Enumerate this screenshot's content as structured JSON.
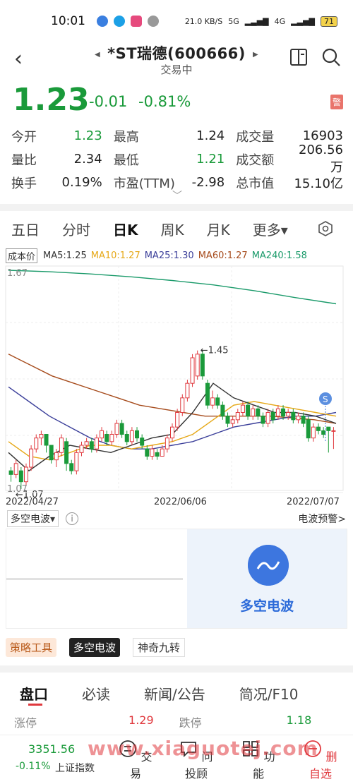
{
  "status_bar": {
    "time": "10:01",
    "net_speed": "21.0 KB/S",
    "signal1": "5G",
    "signal2": "4G",
    "battery": "71"
  },
  "header": {
    "title": "*ST瑞德(600666)",
    "subtitle": "交易中",
    "back_icon": "chevron-left-icon",
    "left_icon": "book-icon",
    "right_icon": "search-icon"
  },
  "quote": {
    "price": "1.23",
    "change": "-0.01",
    "change_pct": "-0.81%",
    "warn_badge": "警",
    "price_color": "#1a9a3a"
  },
  "stats": [
    [
      {
        "label": "今开",
        "value": "1.23",
        "color": "green"
      },
      {
        "label": "最高",
        "value": "1.24",
        "color": "black"
      },
      {
        "label": "成交量",
        "value": "16903",
        "color": "black"
      }
    ],
    [
      {
        "label": "量比",
        "value": "2.34",
        "color": "black"
      },
      {
        "label": "最低",
        "value": "1.21",
        "color": "green"
      },
      {
        "label": "成交额",
        "value": "206.56万",
        "color": "black"
      }
    ],
    [
      {
        "label": "换手",
        "value": "0.19%",
        "color": "black"
      },
      {
        "label": "市盈(TTM)",
        "value": "-2.98",
        "color": "black"
      },
      {
        "label": "总市值",
        "value": "15.10亿",
        "color": "black"
      }
    ]
  ],
  "tabs": [
    "五日",
    "分时",
    "日K",
    "周K",
    "月K",
    "更多▾"
  ],
  "active_tab": "日K",
  "ma_legend": {
    "box": "成本价",
    "items": [
      {
        "text": "MA5:1.25",
        "color": "#333333"
      },
      {
        "text": "MA10:1.27",
        "color": "#e6a817"
      },
      {
        "text": "MA25:1.30",
        "color": "#3b3f9a"
      },
      {
        "text": "MA60:1.27",
        "color": "#a64b1c"
      },
      {
        "text": "MA240:1.58",
        "color": "#1a9a6a"
      }
    ]
  },
  "chart_data": {
    "type": "candlestick",
    "y_top_label": "1.67",
    "y_bottom_label": "1.07",
    "ylim": [
      1.07,
      1.67
    ],
    "high_marker": "←1.45",
    "low_marker": "←1.07",
    "signal_badge": "S",
    "x_labels": [
      "2022/04/27",
      "2022/06/06",
      "2022/07/07"
    ],
    "candles": [
      {
        "o": 1.12,
        "c": 1.11,
        "h": 1.13,
        "l": 1.09
      },
      {
        "o": 1.11,
        "c": 1.14,
        "h": 1.15,
        "l": 1.1
      },
      {
        "o": 1.12,
        "c": 1.09,
        "h": 1.13,
        "l": 1.07
      },
      {
        "o": 1.09,
        "c": 1.13,
        "h": 1.14,
        "l": 1.08
      },
      {
        "o": 1.13,
        "c": 1.18,
        "h": 1.19,
        "l": 1.12
      },
      {
        "o": 1.18,
        "c": 1.21,
        "h": 1.22,
        "l": 1.17
      },
      {
        "o": 1.21,
        "c": 1.22,
        "h": 1.23,
        "l": 1.19
      },
      {
        "o": 1.22,
        "c": 1.19,
        "h": 1.22,
        "l": 1.17
      },
      {
        "o": 1.19,
        "c": 1.15,
        "h": 1.19,
        "l": 1.14
      },
      {
        "o": 1.15,
        "c": 1.17,
        "h": 1.18,
        "l": 1.13
      },
      {
        "o": 1.17,
        "c": 1.21,
        "h": 1.22,
        "l": 1.16
      },
      {
        "o": 1.2,
        "c": 1.14,
        "h": 1.21,
        "l": 1.12
      },
      {
        "o": 1.14,
        "c": 1.12,
        "h": 1.15,
        "l": 1.11
      },
      {
        "o": 1.12,
        "c": 1.17,
        "h": 1.18,
        "l": 1.11
      },
      {
        "o": 1.17,
        "c": 1.19,
        "h": 1.2,
        "l": 1.16
      },
      {
        "o": 1.19,
        "c": 1.2,
        "h": 1.21,
        "l": 1.18
      },
      {
        "o": 1.2,
        "c": 1.18,
        "h": 1.21,
        "l": 1.17
      },
      {
        "o": 1.18,
        "c": 1.21,
        "h": 1.22,
        "l": 1.17
      },
      {
        "o": 1.21,
        "c": 1.23,
        "h": 1.24,
        "l": 1.2
      },
      {
        "o": 1.22,
        "c": 1.2,
        "h": 1.23,
        "l": 1.19
      },
      {
        "o": 1.2,
        "c": 1.22,
        "h": 1.23,
        "l": 1.19
      },
      {
        "o": 1.22,
        "c": 1.25,
        "h": 1.26,
        "l": 1.21
      },
      {
        "o": 1.25,
        "c": 1.22,
        "h": 1.26,
        "l": 1.21
      },
      {
        "o": 1.22,
        "c": 1.2,
        "h": 1.23,
        "l": 1.19
      },
      {
        "o": 1.2,
        "c": 1.23,
        "h": 1.24,
        "l": 1.19
      },
      {
        "o": 1.23,
        "c": 1.21,
        "h": 1.24,
        "l": 1.2
      },
      {
        "o": 1.21,
        "c": 1.19,
        "h": 1.22,
        "l": 1.18
      },
      {
        "o": 1.18,
        "c": 1.16,
        "h": 1.19,
        "l": 1.15
      },
      {
        "o": 1.16,
        "c": 1.18,
        "h": 1.19,
        "l": 1.15
      },
      {
        "o": 1.17,
        "c": 1.16,
        "h": 1.18,
        "l": 1.15
      },
      {
        "o": 1.16,
        "c": 1.18,
        "h": 1.19,
        "l": 1.16
      },
      {
        "o": 1.18,
        "c": 1.21,
        "h": 1.22,
        "l": 1.17
      },
      {
        "o": 1.21,
        "c": 1.24,
        "h": 1.25,
        "l": 1.2
      },
      {
        "o": 1.24,
        "c": 1.28,
        "h": 1.29,
        "l": 1.23
      },
      {
        "o": 1.28,
        "c": 1.32,
        "h": 1.33,
        "l": 1.27
      },
      {
        "o": 1.32,
        "c": 1.36,
        "h": 1.37,
        "l": 1.31
      },
      {
        "o": 1.36,
        "c": 1.43,
        "h": 1.44,
        "l": 1.35
      },
      {
        "o": 1.38,
        "c": 1.44,
        "h": 1.45,
        "l": 1.37
      },
      {
        "o": 1.44,
        "c": 1.38,
        "h": 1.45,
        "l": 1.37
      },
      {
        "o": 1.36,
        "c": 1.3,
        "h": 1.37,
        "l": 1.29
      },
      {
        "o": 1.3,
        "c": 1.32,
        "h": 1.34,
        "l": 1.29
      },
      {
        "o": 1.32,
        "c": 1.3,
        "h": 1.33,
        "l": 1.29
      },
      {
        "o": 1.3,
        "c": 1.27,
        "h": 1.31,
        "l": 1.26
      },
      {
        "o": 1.27,
        "c": 1.25,
        "h": 1.28,
        "l": 1.24
      },
      {
        "o": 1.25,
        "c": 1.26,
        "h": 1.27,
        "l": 1.24
      },
      {
        "o": 1.26,
        "c": 1.28,
        "h": 1.29,
        "l": 1.25
      },
      {
        "o": 1.28,
        "c": 1.3,
        "h": 1.31,
        "l": 1.27
      },
      {
        "o": 1.3,
        "c": 1.27,
        "h": 1.31,
        "l": 1.26
      },
      {
        "o": 1.27,
        "c": 1.29,
        "h": 1.3,
        "l": 1.26
      },
      {
        "o": 1.29,
        "c": 1.27,
        "h": 1.3,
        "l": 1.26
      },
      {
        "o": 1.27,
        "c": 1.25,
        "h": 1.28,
        "l": 1.24
      },
      {
        "o": 1.25,
        "c": 1.28,
        "h": 1.29,
        "l": 1.24
      },
      {
        "o": 1.28,
        "c": 1.26,
        "h": 1.29,
        "l": 1.25
      },
      {
        "o": 1.27,
        "c": 1.29,
        "h": 1.3,
        "l": 1.26
      },
      {
        "o": 1.29,
        "c": 1.27,
        "h": 1.3,
        "l": 1.26
      },
      {
        "o": 1.27,
        "c": 1.28,
        "h": 1.29,
        "l": 1.26
      },
      {
        "o": 1.28,
        "c": 1.26,
        "h": 1.29,
        "l": 1.25
      },
      {
        "o": 1.26,
        "c": 1.27,
        "h": 1.28,
        "l": 1.25
      },
      {
        "o": 1.27,
        "c": 1.25,
        "h": 1.28,
        "l": 1.24
      },
      {
        "o": 1.26,
        "c": 1.21,
        "h": 1.27,
        "l": 1.2
      },
      {
        "o": 1.21,
        "c": 1.24,
        "h": 1.25,
        "l": 1.2
      },
      {
        "o": 1.24,
        "c": 1.23,
        "h": 1.25,
        "l": 1.22
      },
      {
        "o": 1.23,
        "c": 1.22,
        "h": 1.24,
        "l": 1.21
      },
      {
        "o": 1.24,
        "c": 1.23,
        "h": 1.24,
        "l": 1.17
      },
      {
        "o": 1.23,
        "c": 1.23,
        "h": 1.24,
        "l": 1.18
      }
    ],
    "ma_lines": [
      {
        "name": "MA240",
        "color": "#1a9a6a",
        "values": [
          1.67,
          1.666,
          1.66,
          1.652,
          1.642,
          1.63,
          1.614,
          1.595,
          1.578
        ]
      },
      {
        "name": "MA60",
        "color": "#a64b1c",
        "values": [
          1.44,
          1.41,
          1.38,
          1.36,
          1.34,
          1.32,
          1.3,
          1.29,
          1.28,
          1.27,
          1.27,
          1.27,
          1.27,
          1.265,
          1.26,
          1.25
        ]
      },
      {
        "name": "MA25",
        "color": "#3b3f9a",
        "values": [
          1.35,
          1.31,
          1.27,
          1.24,
          1.21,
          1.19,
          1.18,
          1.18,
          1.19,
          1.2,
          1.22,
          1.24,
          1.25,
          1.26,
          1.27,
          1.27,
          1.28
        ]
      },
      {
        "name": "MA10",
        "color": "#e6a817",
        "values": [
          1.2,
          1.16,
          1.15,
          1.17,
          1.19,
          1.19,
          1.18,
          1.19,
          1.2,
          1.22,
          1.26,
          1.3,
          1.31,
          1.3,
          1.29,
          1.28,
          1.27
        ]
      },
      {
        "name": "MA5",
        "color": "#333333",
        "values": [
          1.17,
          1.12,
          1.16,
          1.19,
          1.18,
          1.17,
          1.19,
          1.21,
          1.22,
          1.28,
          1.36,
          1.32,
          1.3,
          1.28,
          1.28,
          1.27,
          1.25
        ]
      }
    ]
  },
  "duokong": {
    "label": "多空电波▾",
    "info": "i",
    "alert": "电波预警>",
    "promo_text": "多空电波"
  },
  "tools": {
    "strategy": "策略工具",
    "selected": "多空电波",
    "other": "神奇九转"
  },
  "bottom_tabs": [
    "盘口",
    "必读",
    "新闻/公告",
    "简况/F10"
  ],
  "peek": {
    "left_label": "涨停",
    "left_value": "1.29",
    "right_label": "跌停",
    "right_value": "1.18"
  },
  "index": {
    "value": "3351.56",
    "pct": "-0.11%",
    "name": "上证指数"
  },
  "bottom_nav": [
    {
      "label": "交易",
      "icon": "trade-icon"
    },
    {
      "label": "问投顾",
      "icon": "chat-icon"
    },
    {
      "label": "功能",
      "icon": "grid-icon"
    },
    {
      "label": "删自选",
      "icon": "minus-circle-icon"
    }
  ],
  "watermark": "www.xiaguotej.com"
}
